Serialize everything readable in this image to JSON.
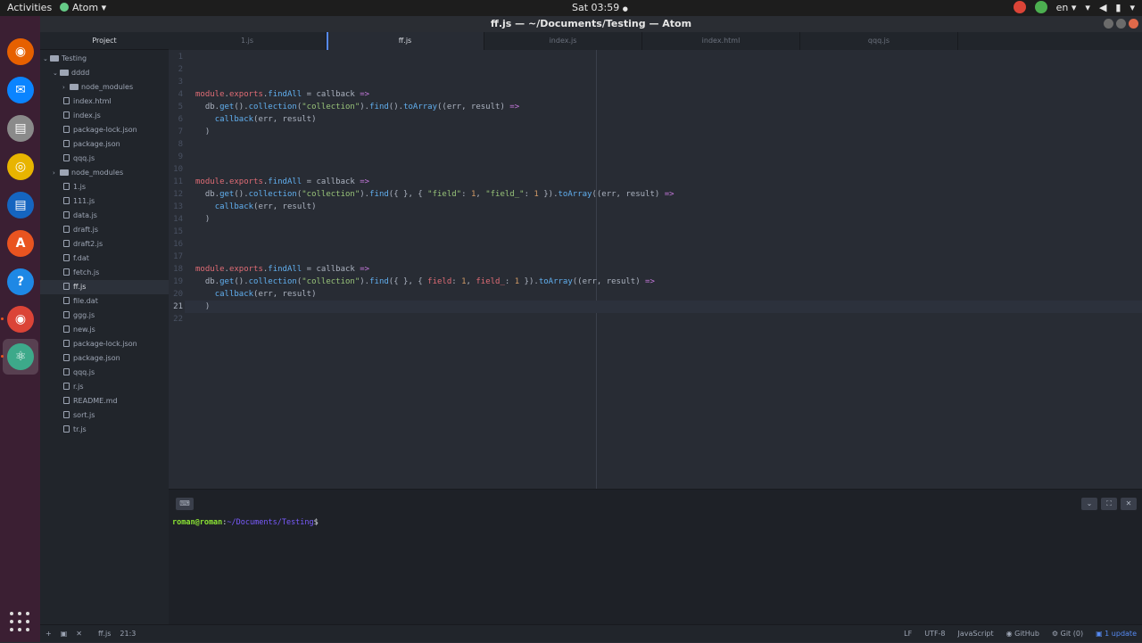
{
  "topbar": {
    "activities": "Activities",
    "app_name": "Atom",
    "app_menu_arrow": "▾",
    "clock": "Sat 03:59",
    "clock_dot": "●",
    "language": "en ▾",
    "wifi_icon": "▾",
    "volume_icon": "◀",
    "battery_icon": "▮",
    "power_icon": "▾"
  },
  "window": {
    "title": "ff.js — ~/Documents/Testing — Atom"
  },
  "dock": {
    "items": [
      {
        "name": "firefox",
        "glyph": "◉",
        "color": "#e66000"
      },
      {
        "name": "thunderbird",
        "glyph": "✉",
        "color": "#0a84ff"
      },
      {
        "name": "files",
        "glyph": "▤",
        "color": "#8a8a8a"
      },
      {
        "name": "rhythmbox",
        "glyph": "◎",
        "color": "#e8b400"
      },
      {
        "name": "libreoffice-writer",
        "glyph": "▤",
        "color": "#1565c0"
      },
      {
        "name": "software-center",
        "glyph": "A",
        "color": "#e95420"
      },
      {
        "name": "help",
        "glyph": "?",
        "color": "#1e88e5"
      },
      {
        "name": "chrome",
        "glyph": "◉",
        "color": "#db4437"
      },
      {
        "name": "atom",
        "glyph": "⚛",
        "color": "#3da98a"
      }
    ]
  },
  "tree": {
    "header": "Project",
    "rows": [
      {
        "label": "Testing",
        "type": "folder",
        "indent": 0,
        "arrow": "⌄"
      },
      {
        "label": "dddd",
        "type": "folder",
        "indent": 1,
        "arrow": "⌄"
      },
      {
        "label": "node_modules",
        "type": "folder",
        "indent": 2,
        "arrow": "›"
      },
      {
        "label": "index.html",
        "type": "file",
        "indent": 2
      },
      {
        "label": "index.js",
        "type": "file",
        "indent": 2
      },
      {
        "label": "package-lock.json",
        "type": "file",
        "indent": 2
      },
      {
        "label": "package.json",
        "type": "file",
        "indent": 2
      },
      {
        "label": "qqq.js",
        "type": "file",
        "indent": 2
      },
      {
        "label": "node_modules",
        "type": "folder",
        "indent": 1,
        "arrow": "›"
      },
      {
        "label": "1.js",
        "type": "file",
        "indent": 1
      },
      {
        "label": "111.js",
        "type": "file",
        "indent": 1
      },
      {
        "label": "data.js",
        "type": "file",
        "indent": 1
      },
      {
        "label": "draft.js",
        "type": "file",
        "indent": 1
      },
      {
        "label": "draft2.js",
        "type": "file",
        "indent": 1
      },
      {
        "label": "f.dat",
        "type": "file",
        "indent": 1
      },
      {
        "label": "fetch.js",
        "type": "file",
        "indent": 1
      },
      {
        "label": "ff.js",
        "type": "file",
        "indent": 1,
        "selected": true
      },
      {
        "label": "file.dat",
        "type": "file",
        "indent": 1
      },
      {
        "label": "ggg.js",
        "type": "file",
        "indent": 1
      },
      {
        "label": "new.js",
        "type": "file",
        "indent": 1
      },
      {
        "label": "package-lock.json",
        "type": "file",
        "indent": 1
      },
      {
        "label": "package.json",
        "type": "file",
        "indent": 1
      },
      {
        "label": "qqq.js",
        "type": "file",
        "indent": 1
      },
      {
        "label": "r.js",
        "type": "file",
        "indent": 1
      },
      {
        "label": "README.md",
        "type": "file",
        "indent": 1
      },
      {
        "label": "sort.js",
        "type": "file",
        "indent": 1
      },
      {
        "label": "tr.js",
        "type": "file",
        "indent": 1
      }
    ]
  },
  "tabs": [
    {
      "label": "1.js",
      "active": false
    },
    {
      "label": "ff.js",
      "active": true
    },
    {
      "label": "index.js",
      "active": false
    },
    {
      "label": "index.html",
      "active": false
    },
    {
      "label": "qqq.js",
      "active": false
    }
  ],
  "editor": {
    "cursor_line": 21,
    "lines": [
      [],
      [],
      [],
      [
        [
          "mod",
          "module"
        ],
        [
          "pun",
          "."
        ],
        [
          "mod",
          "exports"
        ],
        [
          "pun",
          "."
        ],
        [
          "fn",
          "findAll"
        ],
        [
          "pun",
          " = callback "
        ],
        [
          "kw",
          "=>"
        ]
      ],
      [
        [
          "pun",
          "  db."
        ],
        [
          "fn",
          "get"
        ],
        [
          "pun",
          "()."
        ],
        [
          "fn",
          "collection"
        ],
        [
          "pun",
          "("
        ],
        [
          "str",
          "\"collection\""
        ],
        [
          "pun",
          ")."
        ],
        [
          "fn",
          "find"
        ],
        [
          "pun",
          "()."
        ],
        [
          "fn",
          "toArray"
        ],
        [
          "pun",
          "((err, result) "
        ],
        [
          "kw",
          "=>"
        ]
      ],
      [
        [
          "pun",
          "    "
        ],
        [
          "fn",
          "callback"
        ],
        [
          "pun",
          "(err, result)"
        ]
      ],
      [
        [
          "pun",
          "  )"
        ]
      ],
      [],
      [],
      [],
      [
        [
          "mod",
          "module"
        ],
        [
          "pun",
          "."
        ],
        [
          "mod",
          "exports"
        ],
        [
          "pun",
          "."
        ],
        [
          "fn",
          "findAll"
        ],
        [
          "pun",
          " = callback "
        ],
        [
          "kw",
          "=>"
        ]
      ],
      [
        [
          "pun",
          "  db."
        ],
        [
          "fn",
          "get"
        ],
        [
          "pun",
          "()."
        ],
        [
          "fn",
          "collection"
        ],
        [
          "pun",
          "("
        ],
        [
          "str",
          "\"collection\""
        ],
        [
          "pun",
          ")."
        ],
        [
          "fn",
          "find"
        ],
        [
          "pun",
          "({ }, { "
        ],
        [
          "str",
          "\"field\""
        ],
        [
          "pun",
          ": "
        ],
        [
          "num",
          "1"
        ],
        [
          "pun",
          ", "
        ],
        [
          "str",
          "\"field_\""
        ],
        [
          "pun",
          ": "
        ],
        [
          "num",
          "1"
        ],
        [
          "pun",
          " })."
        ],
        [
          "fn",
          "toArray"
        ],
        [
          "pun",
          "((err, result) "
        ],
        [
          "kw",
          "=>"
        ]
      ],
      [
        [
          "pun",
          "    "
        ],
        [
          "fn",
          "callback"
        ],
        [
          "pun",
          "(err, result)"
        ]
      ],
      [
        [
          "pun",
          "  )"
        ]
      ],
      [],
      [],
      [],
      [
        [
          "mod",
          "module"
        ],
        [
          "pun",
          "."
        ],
        [
          "mod",
          "exports"
        ],
        [
          "pun",
          "."
        ],
        [
          "fn",
          "findAll"
        ],
        [
          "pun",
          " = callback "
        ],
        [
          "kw",
          "=>"
        ]
      ],
      [
        [
          "pun",
          "  db."
        ],
        [
          "fn",
          "get"
        ],
        [
          "pun",
          "()."
        ],
        [
          "fn",
          "collection"
        ],
        [
          "pun",
          "("
        ],
        [
          "str",
          "\"collection\""
        ],
        [
          "pun",
          ")."
        ],
        [
          "fn",
          "find"
        ],
        [
          "pun",
          "({ }, { "
        ],
        [
          "mod",
          "field"
        ],
        [
          "pun",
          ": "
        ],
        [
          "num",
          "1"
        ],
        [
          "pun",
          ", "
        ],
        [
          "mod",
          "field_"
        ],
        [
          "pun",
          ": "
        ],
        [
          "num",
          "1"
        ],
        [
          "pun",
          " })."
        ],
        [
          "fn",
          "toArray"
        ],
        [
          "pun",
          "((err, result) "
        ],
        [
          "kw",
          "=>"
        ]
      ],
      [
        [
          "pun",
          "    "
        ],
        [
          "fn",
          "callback"
        ],
        [
          "pun",
          "(err, result)"
        ]
      ],
      [
        [
          "pun",
          "  )"
        ]
      ],
      []
    ]
  },
  "terminal": {
    "button_icon": "⌨",
    "user_host": "roman@roman",
    "colon": ":",
    "path": "~/Documents/Testing",
    "dollar": "$",
    "ctrl_minimize": "⌄",
    "ctrl_maximize": "⛶",
    "ctrl_close": "✕"
  },
  "status": {
    "add_icon": "+",
    "terminal_icon": "▣",
    "close_icon": "✕",
    "file": "ff.js",
    "cursor": "21:3",
    "line_ending": "LF",
    "encoding": "UTF-8",
    "grammar": "JavaScript",
    "github": "GitHub",
    "git": "Git (0)",
    "updates": "1 update"
  },
  "colors": {
    "accent": "#568af2",
    "string": "#98c379",
    "keyword": "#c678dd",
    "function": "#61afef",
    "property": "#e06c75",
    "number": "#d19a66",
    "terminal_user": "#8ae234",
    "terminal_path": "#7a5cff"
  }
}
